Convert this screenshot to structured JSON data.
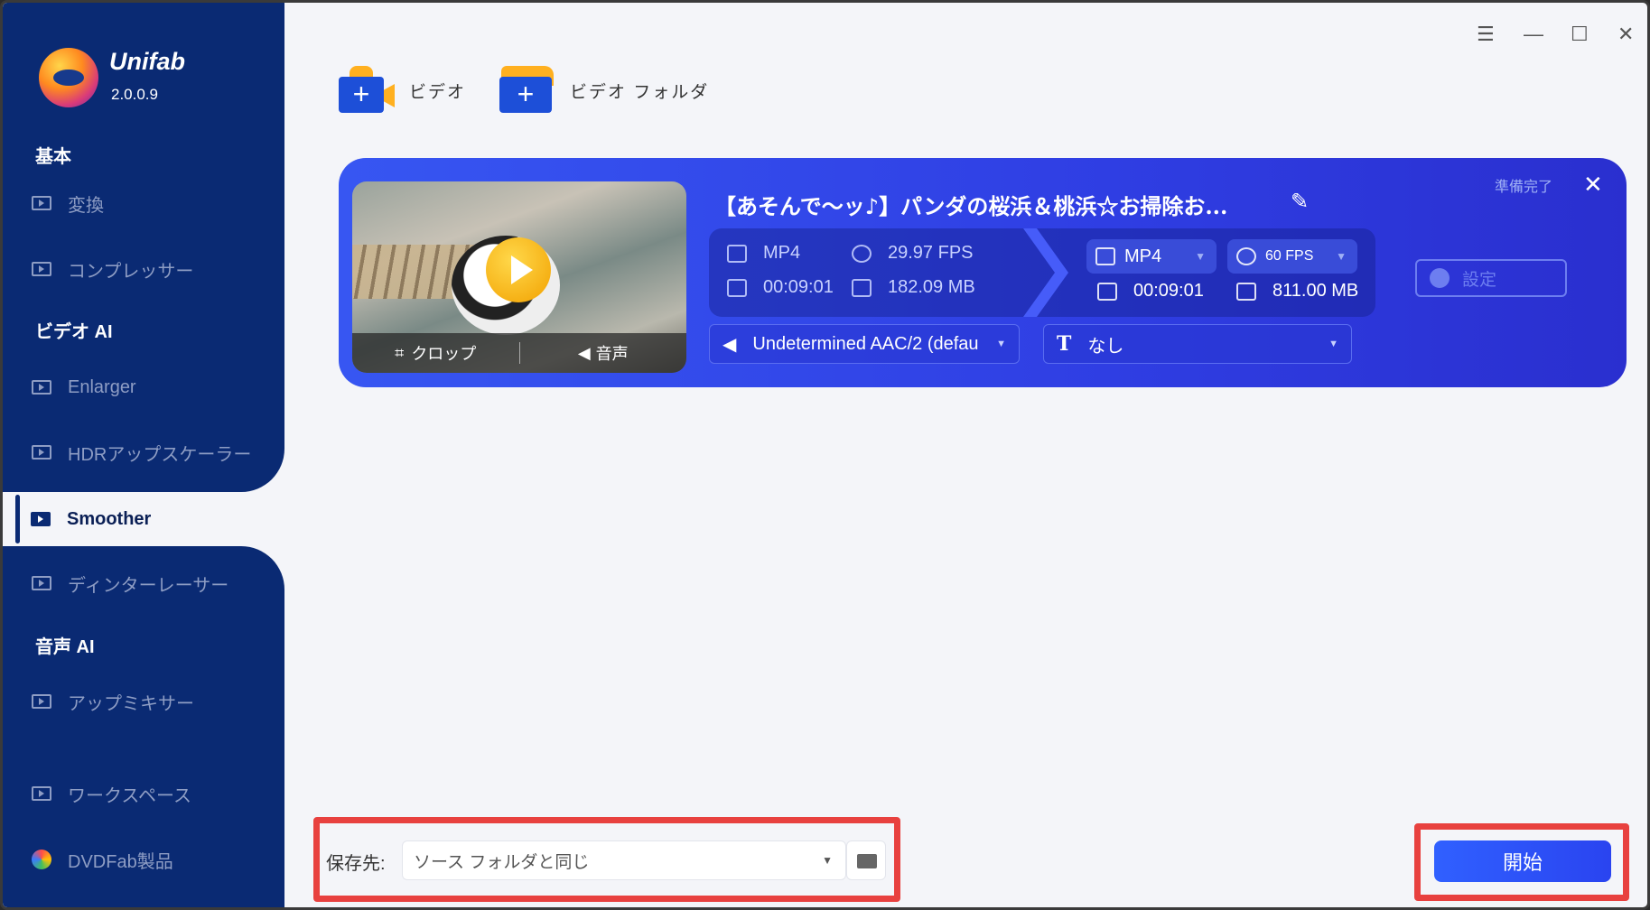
{
  "app": {
    "name": "Unifab",
    "version": "2.0.0.9"
  },
  "window_controls": {
    "menu": "☰",
    "minimize": "—",
    "maximize": "☐",
    "close": "✕"
  },
  "sidebar": {
    "sections": {
      "basic": "基本",
      "video_ai": "ビデオ AI",
      "audio_ai": "音声 AI"
    },
    "items": {
      "convert": "変換",
      "compressor": "コンプレッサー",
      "enlarger": "Enlarger",
      "hdr": "HDRアップスケーラー",
      "smoother": "Smoother",
      "deinterlacer": "ディンターレーサー",
      "upmixer": "アップミキサー",
      "workspace": "ワークスペース",
      "dvdfab": "DVDFab製品"
    },
    "active": "smoother"
  },
  "toolbar": {
    "add_video": "ビデオ",
    "add_folder": "ビデオ フォルダ",
    "plus": "+"
  },
  "task": {
    "title": "【あそんで〜ッ♪】パンダの桜浜＆桃浜☆お掃除お...",
    "status": "準備完了",
    "close": "✕",
    "edit": "✎",
    "thumb_crop": "クロップ",
    "thumb_audio": "音声",
    "source": {
      "format": "MP4",
      "fps": "29.97 FPS",
      "duration": "00:09:01",
      "size": "182.09 MB"
    },
    "output": {
      "format": "MP4",
      "fps": "60 FPS",
      "duration": "00:09:01",
      "size": "811.00 MB"
    },
    "settings_label": "設定",
    "audio_track": "Undetermined AAC/2 (defau",
    "subtitle_icon": "T",
    "subtitle": "なし"
  },
  "bottom": {
    "save_label": "保存先:",
    "save_value": "ソース フォルダと同じ",
    "start_label": "開始"
  },
  "colors": {
    "sidebar_bg": "#0a2a73",
    "card_gradient_start": "#3756f2",
    "highlight": "#e8413f",
    "start_button": "#2a44f0"
  }
}
